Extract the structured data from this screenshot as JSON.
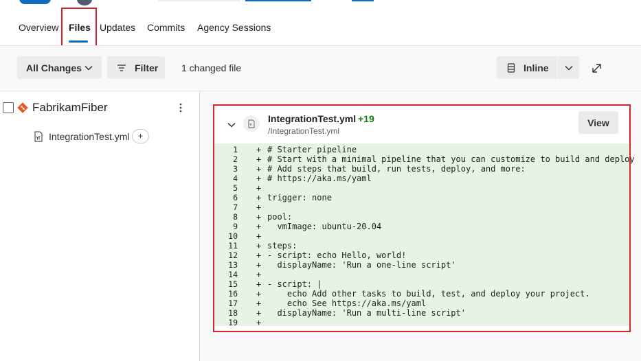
{
  "tabs": [
    {
      "label": "Overview"
    },
    {
      "label": "Files"
    },
    {
      "label": "Updates"
    },
    {
      "label": "Commits"
    },
    {
      "label": "Agency Sessions"
    }
  ],
  "toolbar": {
    "all_changes_label": "All Changes",
    "filter_label": "Filter",
    "changed_count": "1 changed file",
    "view_mode_label": "Inline"
  },
  "tree": {
    "repo_name": "FabrikamFiber",
    "file_name": "IntegrationTest.yml",
    "add_label": "+"
  },
  "diff": {
    "file_name": "IntegrationTest.yml",
    "added_count": "+19",
    "path": "/IntegrationTest.yml",
    "view_label": "View",
    "lines": [
      {
        "num": "1",
        "sign": "+",
        "text": "# Starter pipeline"
      },
      {
        "num": "2",
        "sign": "+",
        "text": "# Start with a minimal pipeline that you can customize to build and deploy"
      },
      {
        "num": "3",
        "sign": "+",
        "text": "# Add steps that build, run tests, deploy, and more:"
      },
      {
        "num": "4",
        "sign": "+",
        "text": "# https://aka.ms/yaml"
      },
      {
        "num": "5",
        "sign": "+",
        "text": ""
      },
      {
        "num": "6",
        "sign": "+",
        "text": "trigger: none"
      },
      {
        "num": "7",
        "sign": "+",
        "text": ""
      },
      {
        "num": "8",
        "sign": "+",
        "text": "pool:"
      },
      {
        "num": "9",
        "sign": "+",
        "text": "  vmImage: ubuntu-20.04"
      },
      {
        "num": "10",
        "sign": "+",
        "text": ""
      },
      {
        "num": "11",
        "sign": "+",
        "text": "steps:"
      },
      {
        "num": "12",
        "sign": "+",
        "text": "- script: echo Hello, world!"
      },
      {
        "num": "13",
        "sign": "+",
        "text": "  displayName: 'Run a one-line script'"
      },
      {
        "num": "14",
        "sign": "+",
        "text": ""
      },
      {
        "num": "15",
        "sign": "+",
        "text": "- script: |"
      },
      {
        "num": "16",
        "sign": "+",
        "text": "    echo Add other tasks to build, test, and deploy your project."
      },
      {
        "num": "17",
        "sign": "+",
        "text": "    echo See https://aka.ms/yaml"
      },
      {
        "num": "18",
        "sign": "+",
        "text": "  displayName: 'Run a multi-line script'"
      },
      {
        "num": "19",
        "sign": "+",
        "text": ""
      }
    ]
  },
  "colors": {
    "accent": "#0f6cbd",
    "highlight_border": "#d9232b",
    "added_text": "#107c10",
    "added_background": "#e6f3e5",
    "git_icon": "#e8562a"
  },
  "icons": {
    "all_changes_dropdown": "chevron-down-icon",
    "filter": "filter-icon",
    "inline_view": "inline-view-icon",
    "inline_dropdown": "chevron-down-icon",
    "expand": "expand-icon",
    "repo": "git-icon",
    "more": "more-vertical-icon",
    "file": "yaml-file-icon",
    "collapse": "chevron-down-icon"
  }
}
